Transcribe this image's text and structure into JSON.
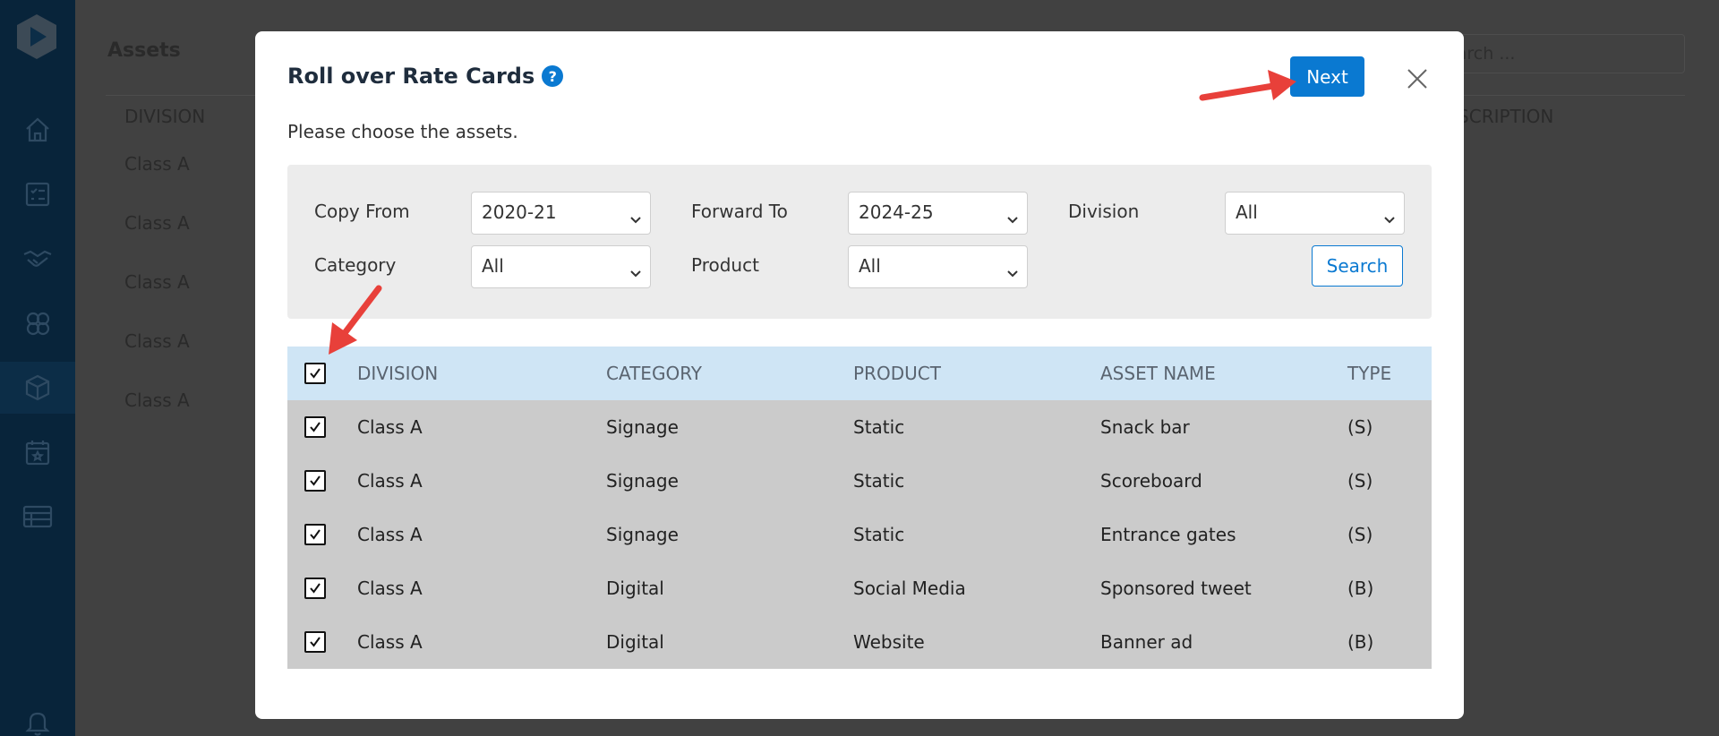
{
  "background": {
    "page_title": "Assets",
    "search_placeholder": "Search ...",
    "columns": [
      "DIVISION",
      "DESCRIPTION"
    ],
    "rows": [
      "Class A",
      "Class A",
      "Class A",
      "Class A",
      "Class A"
    ]
  },
  "sidebar": {
    "items": [
      "home-icon",
      "checklist-icon",
      "handshake-icon",
      "group-icon",
      "assets-box-icon",
      "calendar-icon",
      "table-icon",
      "bell-icon"
    ],
    "active": "assets-box-icon"
  },
  "modal": {
    "title": "Roll over Rate Cards",
    "help_glyph": "?",
    "next_label": "Next",
    "subtitle": "Please choose the assets.",
    "filters": {
      "copy_from_label": "Copy From",
      "copy_from_value": "2020-21",
      "forward_to_label": "Forward To",
      "forward_to_value": "2024-25",
      "division_label": "Division",
      "division_value": "All",
      "category_label": "Category",
      "category_value": "All",
      "product_label": "Product",
      "product_value": "All",
      "search_label": "Search"
    },
    "table": {
      "headers": [
        "DIVISION",
        "CATEGORY",
        "PRODUCT",
        "ASSET NAME",
        "TYPE"
      ],
      "select_all_checked": true,
      "rows": [
        {
          "division": "Class A",
          "category": "Signage",
          "product": "Static",
          "asset_name": "Snack bar",
          "type": "(S)",
          "checked": true
        },
        {
          "division": "Class A",
          "category": "Signage",
          "product": "Static",
          "asset_name": "Scoreboard",
          "type": "(S)",
          "checked": true
        },
        {
          "division": "Class A",
          "category": "Signage",
          "product": "Static",
          "asset_name": "Entrance gates",
          "type": "(S)",
          "checked": true
        },
        {
          "division": "Class A",
          "category": "Digital",
          "product": "Social Media",
          "asset_name": "Sponsored tweet",
          "type": "(B)",
          "checked": true
        },
        {
          "division": "Class A",
          "category": "Digital",
          "product": "Website",
          "asset_name": "Banner ad",
          "type": "(B)",
          "checked": true
        }
      ]
    }
  },
  "colors": {
    "accent": "#0a79d1",
    "annotation_arrow": "#e8403a",
    "header_row": "#cfe5f5",
    "body_row": "#cbcbcb"
  }
}
